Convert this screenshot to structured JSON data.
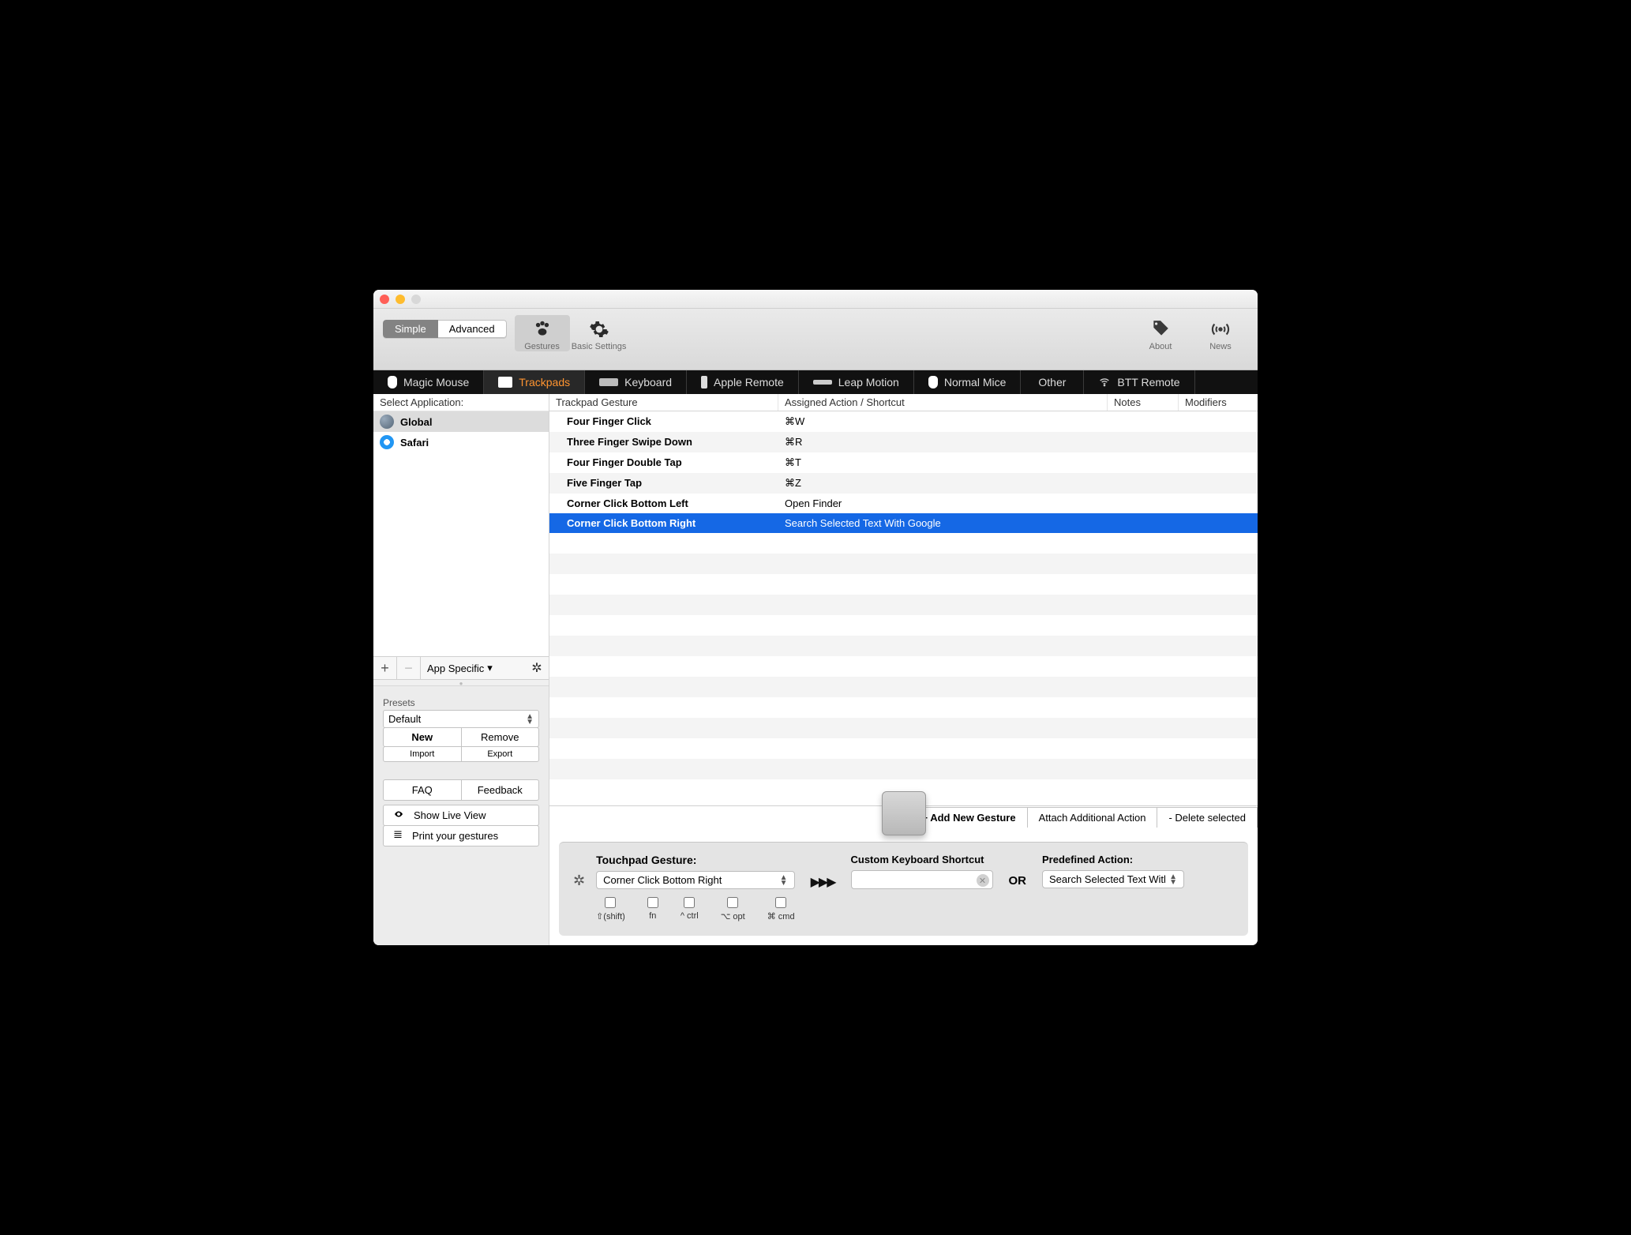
{
  "toolbar": {
    "segments": {
      "simple": "Simple",
      "advanced": "Advanced"
    },
    "items": {
      "gestures": "Gestures",
      "basic_settings": "Basic Settings",
      "about": "About",
      "news": "News"
    }
  },
  "device_tabs": [
    {
      "label": "Magic Mouse"
    },
    {
      "label": "Trackpads"
    },
    {
      "label": "Keyboard"
    },
    {
      "label": "Apple Remote"
    },
    {
      "label": "Leap Motion"
    },
    {
      "label": "Normal Mice"
    },
    {
      "label": "Other"
    },
    {
      "label": "BTT Remote"
    }
  ],
  "sidebar": {
    "header": "Select Application:",
    "apps": [
      {
        "label": "Global"
      },
      {
        "label": "Safari"
      }
    ],
    "app_specific": "App Specific",
    "presets_label": "Presets",
    "preset_selected": "Default",
    "new_btn": "New",
    "remove_btn": "Remove",
    "import_btn": "Import",
    "export_btn": "Export",
    "faq_btn": "FAQ",
    "feedback_btn": "Feedback",
    "show_live": "Show Live View",
    "print_gestures": "Print your gestures"
  },
  "table": {
    "headers": {
      "gesture": "Trackpad Gesture",
      "action": "Assigned Action / Shortcut",
      "notes": "Notes",
      "modifiers": "Modifiers"
    },
    "rows": [
      {
        "gesture": "Four Finger Click",
        "action": "⌘W"
      },
      {
        "gesture": "Three Finger Swipe Down",
        "action": "⌘R"
      },
      {
        "gesture": "Four Finger Double Tap",
        "action": "⌘T"
      },
      {
        "gesture": "Five Finger Tap",
        "action": "⌘Z"
      },
      {
        "gesture": "Corner Click Bottom Left",
        "action": "Open Finder"
      },
      {
        "gesture": "Corner Click Bottom Right",
        "action": "Search Selected Text With Google",
        "selected": true
      }
    ]
  },
  "actions": {
    "add": "+ Add New Gesture",
    "attach": "Attach Additional Action",
    "delete": "- Delete selected"
  },
  "editor": {
    "gesture_label": "Touchpad Gesture:",
    "gesture_value": "Corner Click Bottom Right",
    "shortcut_label": "Custom Keyboard Shortcut",
    "or": "OR",
    "action_label": "Predefined Action:",
    "action_value": "Search Selected Text Witl",
    "modifiers": {
      "shift": "⇧(shift)",
      "fn": "fn",
      "ctrl": "^ ctrl",
      "opt": "⌥ opt",
      "cmd": "⌘ cmd"
    }
  }
}
